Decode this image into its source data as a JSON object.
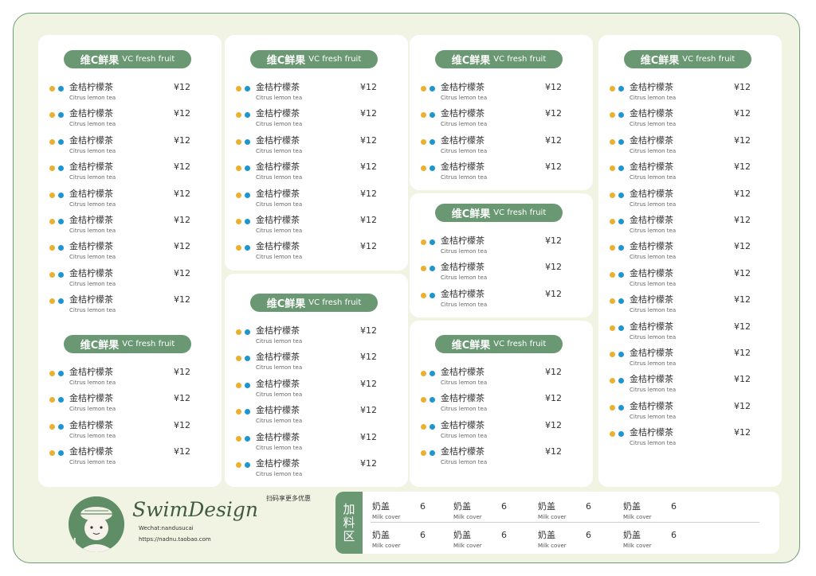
{
  "section_title": {
    "zh": "维C鲜果",
    "en": "VC fresh fruit"
  },
  "item": {
    "name": "金桔柠檬茶",
    "en": "Citrus lemon tea",
    "price": "¥12"
  },
  "sections": [
    {
      "id": "col1-top",
      "count": 9
    },
    {
      "id": "col1-bottom",
      "count": 4
    },
    {
      "id": "col2-top",
      "count": 7
    },
    {
      "id": "col2-bottom",
      "count": 6
    },
    {
      "id": "col3-top",
      "count": 4
    },
    {
      "id": "col3-middle",
      "count": 3
    },
    {
      "id": "col3-bottom",
      "count": 4
    },
    {
      "id": "col4",
      "count": 14
    }
  ],
  "brand": {
    "name": "SwimDesign",
    "wechat": "Wechat:nandusucai",
    "url": "https://nadnu.taobao.com",
    "scan_text": "扫码享更多优惠"
  },
  "toppings": {
    "label": [
      "加",
      "料",
      "区"
    ],
    "item": {
      "name": "奶盖",
      "en": "Milk cover",
      "price": "6"
    },
    "rows": 2,
    "per_row": 4
  },
  "colors": {
    "green": "#699872",
    "dot_yellow": "#ebb02f",
    "dot_blue": "#1d95d0",
    "background": "#f1f4e3"
  }
}
